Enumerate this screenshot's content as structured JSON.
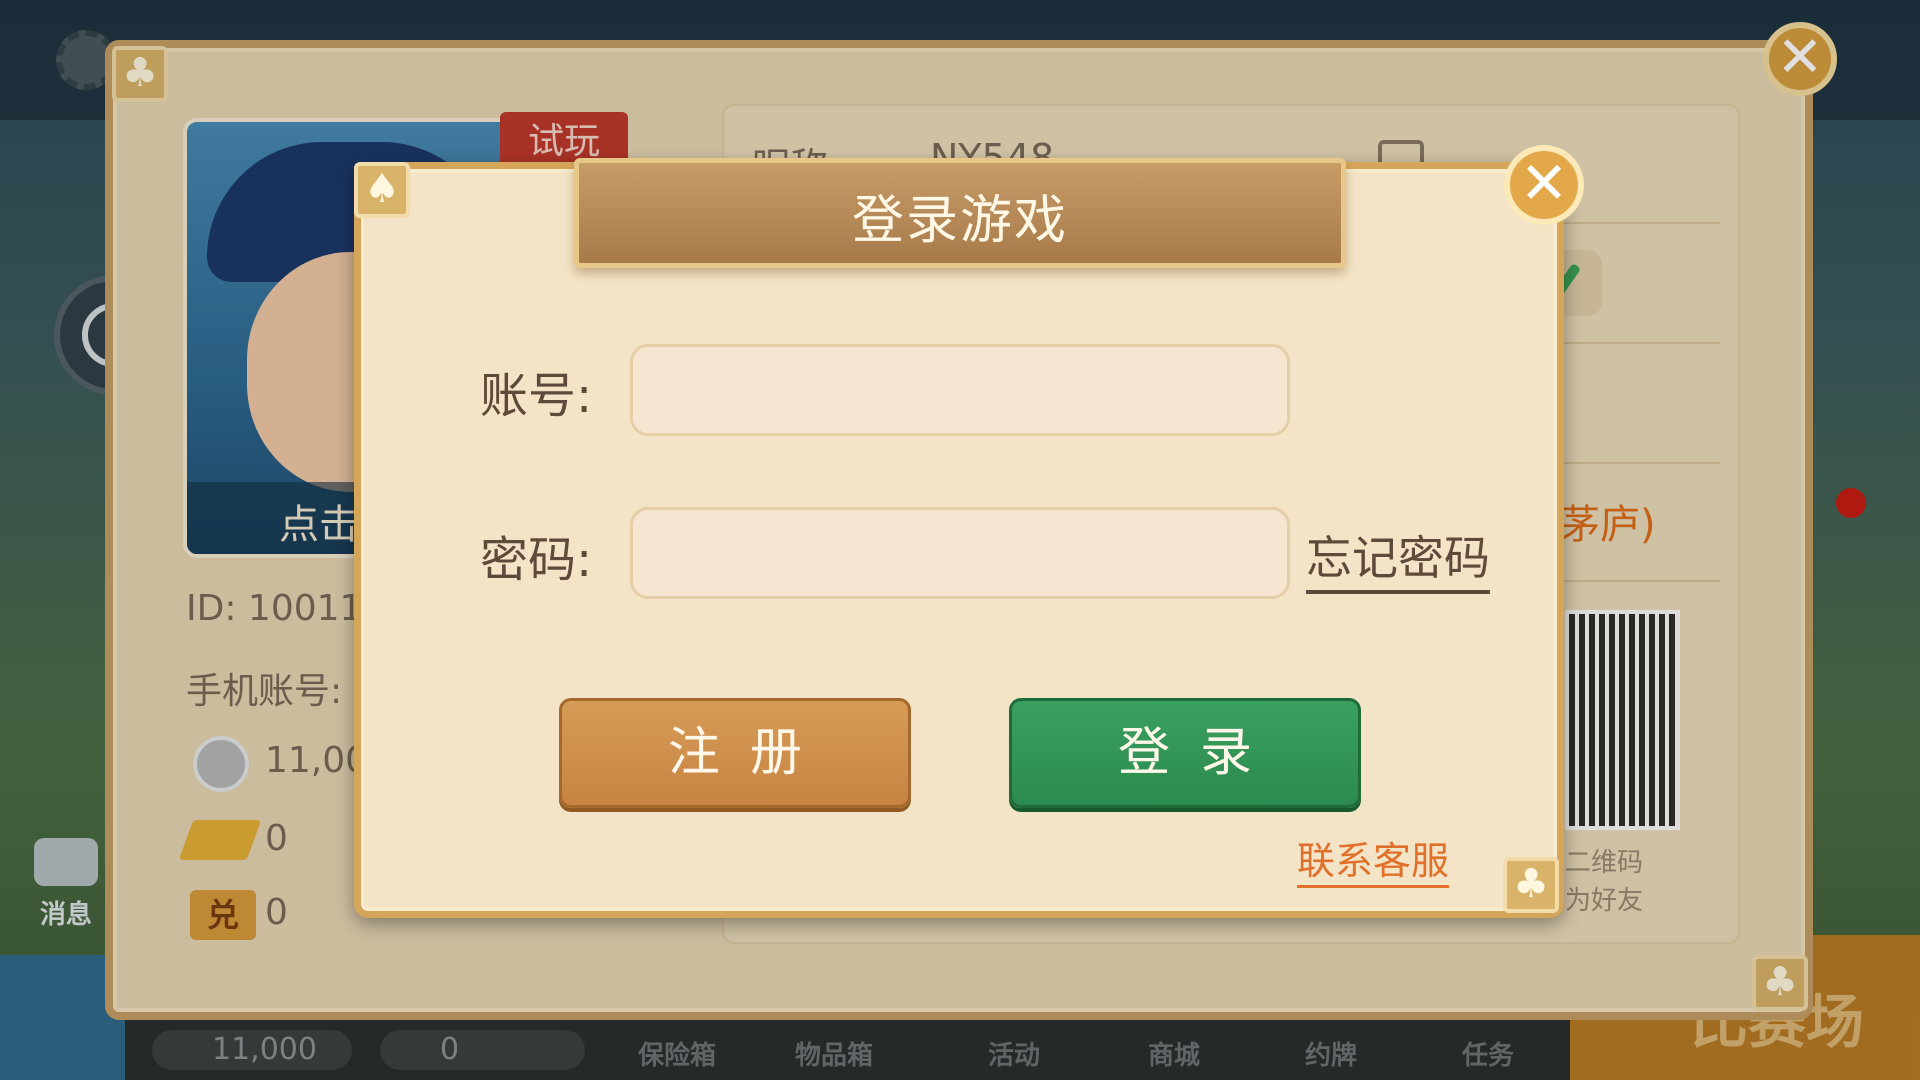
{
  "profile_panel": {
    "portrait_label": "点击",
    "trial_badge": "试玩",
    "id_text": "ID: 10011",
    "phone_text": "手机账号:",
    "coins": "11,00",
    "gold": "0",
    "exchange_icon_label": "兑",
    "exchange_value": "0",
    "nickname_label": "昵称",
    "nickname_value": "NY548",
    "rank_text": "茅庐)",
    "qr_caption_line1": "二维码",
    "qr_caption_line2": "为好友"
  },
  "background": {
    "message_label": "消息",
    "bottom_coins": "11,000",
    "bottom_gold": "0",
    "bottom_tabs": [
      "保险箱",
      "物品箱",
      "活动",
      "商城",
      "约牌",
      "任务"
    ],
    "right_label": "比赛场"
  },
  "login_dialog": {
    "title": "登录游戏",
    "account_label": "账号:",
    "account_value": "",
    "account_placeholder": "",
    "password_label": "密码:",
    "password_value": "",
    "password_placeholder": "",
    "forgot_password": "忘记密码",
    "register_button": "注册",
    "login_button": "登录",
    "contact_support": "联系客服"
  },
  "icons": {
    "close": "close-icon",
    "corner": "club-suit-icon",
    "corner_spade": "spade-suit-icon"
  },
  "colors": {
    "dialog_bg": "#f4e4c7",
    "title_bar": "#b7895a",
    "register_button": "#cf8c4c",
    "login_button": "#349858",
    "support_link": "#e0702a"
  }
}
